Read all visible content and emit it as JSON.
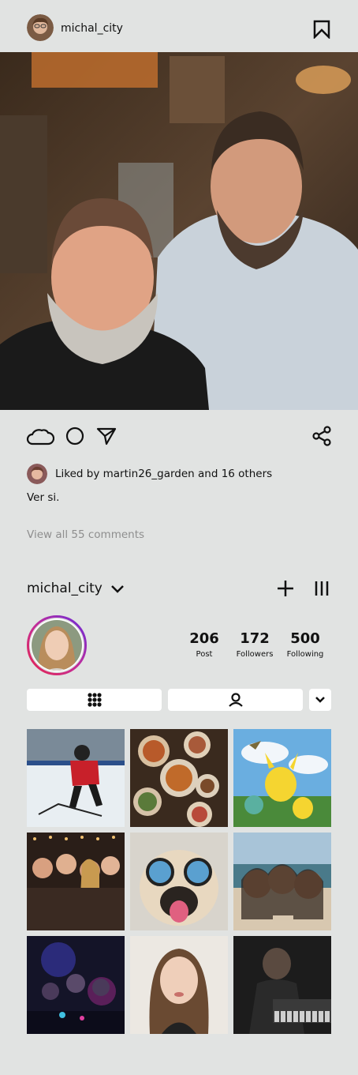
{
  "post": {
    "username": "michal_city",
    "liked_by_prefix": "Liked by ",
    "liked_by_user": "martin26_garden",
    "liked_by_suffix": " and 16 others",
    "caption": "Ver si.",
    "view_comments": "View all 55 comments"
  },
  "profile": {
    "username": "michal_city",
    "stats": [
      {
        "value": "206",
        "label": "Post"
      },
      {
        "value": "172",
        "label": "Followers"
      },
      {
        "value": "500",
        "label": "Following"
      }
    ]
  },
  "icons": {
    "bookmark": "bookmark-icon",
    "like": "cloud-icon",
    "comment": "circle-icon",
    "send": "send-icon",
    "share": "share-icon",
    "dropdown": "chevron-down-icon",
    "add": "plus-icon",
    "menu": "menu-icon",
    "grid": "grid-icon",
    "tagged": "person-icon"
  },
  "colors": {
    "background": "#e1e3e2",
    "text": "#111111",
    "muted": "#8e8e8e",
    "story_ring_start": "#d9245d",
    "story_ring_end": "#6a2bd8"
  }
}
